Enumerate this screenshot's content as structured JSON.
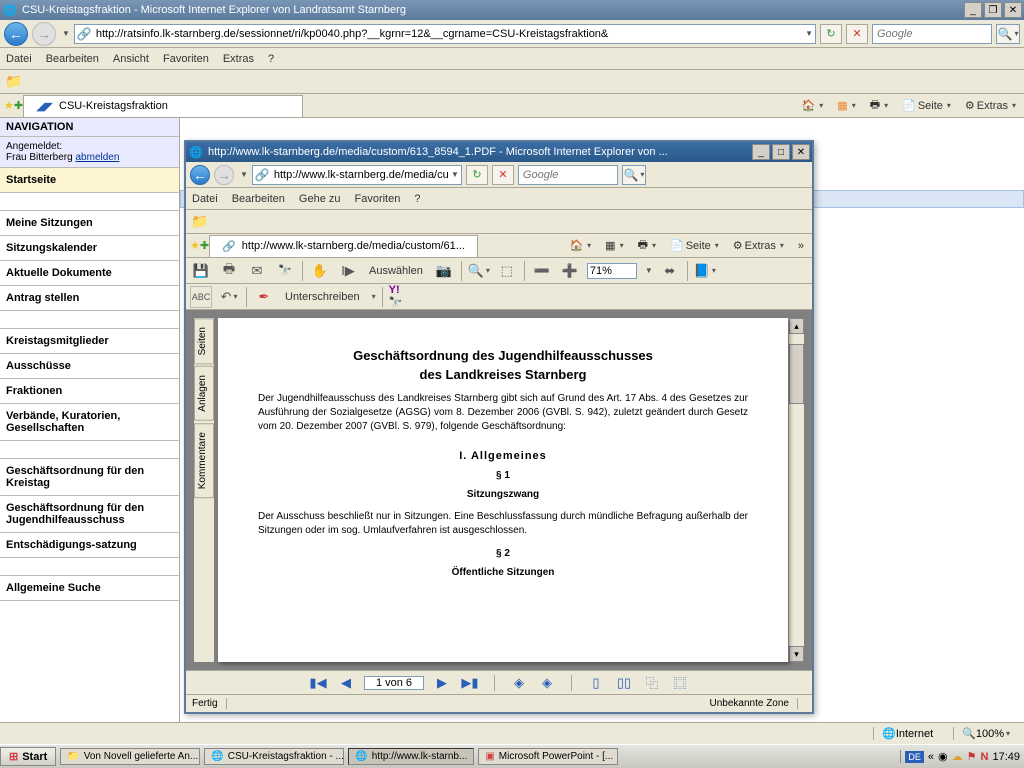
{
  "main_window": {
    "title": "CSU-Kreistagsfraktion - Microsoft Internet Explorer von Landratsamt Starnberg",
    "url": "http://ratsinfo.lk-starnberg.de/sessionnet/ri/kp0040.php?__kgrnr=12&__cgrname=CSU-Kreistagsfraktion&",
    "search_placeholder": "Google",
    "menu": {
      "datei": "Datei",
      "bearbeiten": "Bearbeiten",
      "ansicht": "Ansicht",
      "favoriten": "Favoriten",
      "extras": "Extras",
      "hilfe": "?"
    },
    "tab_label": "CSU-Kreistagsfraktion",
    "tool_labels": {
      "seite": "Seite",
      "extras": "Extras"
    },
    "status": {
      "internet": "Internet",
      "zoom": "100%"
    }
  },
  "sidebar": {
    "header": "NAVIGATION",
    "login_label": "Angemeldet:",
    "login_user": "Frau Bitterberg",
    "logout": "abmelden",
    "items": [
      "Startseite",
      "Meine Sitzungen",
      "Sitzungskalender",
      "Aktuelle Dokumente",
      "Antrag stellen",
      "Kreistagsmitglieder",
      "Ausschüsse",
      "Fraktionen",
      "Verbände, Kuratorien, Gesellschaften",
      "Geschäftsordnung für den Kreistag",
      "Geschäftsordnung für den Jugendhilfeausschuss",
      "Entschädigungs-satzung",
      "Allgemeine Suche"
    ]
  },
  "pdf_window": {
    "title": "http://www.lk-starnberg.de/media/custom/613_8594_1.PDF - Microsoft Internet Explorer von ...",
    "url": "http://www.lk-starnberg.de/media/custom",
    "addr_display": "http://www.lk-starnberg.de/media/custom/61...",
    "search_placeholder": "Google",
    "menu": {
      "datei": "Datei",
      "bearbeiten": "Bearbeiten",
      "gehezu": "Gehe zu",
      "favoriten": "Favoriten",
      "hilfe": "?"
    },
    "tool_labels": {
      "seite": "Seite",
      "extras": "Extras"
    },
    "pdf_toolbar": {
      "auswaehlen": "Auswählen",
      "unterschreiben": "Unterschreiben",
      "zoom": "71%"
    },
    "sidetabs": {
      "seiten": "Seiten",
      "anlagen": "Anlagen",
      "kommentare": "Kommentare"
    },
    "pager": "1 von 6",
    "status": {
      "fertig": "Fertig",
      "zone": "Unbekannte Zone"
    },
    "document": {
      "title1": "Geschäftsordnung des Jugendhilfeausschusses",
      "title2": "des Landkreises Starnberg",
      "intro": "Der Jugendhilfeausschuss des Landkreises Starnberg gibt sich auf Grund des Art. 17 Abs. 4 des Gesetzes zur Ausführung der Sozialgesetze (AGSG) vom 8. Dezember 2006 (GVBl. S. 942), zuletzt geändert durch Gesetz vom 20. Dezember 2007 (GVBl. S. 979), folgende Geschäftsordnung:",
      "s1": "I. Allgemeines",
      "s1_1": "§ 1",
      "s1_1t": "Sitzungszwang",
      "s1_1b": "Der Ausschuss beschließt nur in Sitzungen. Eine Beschlussfassung durch mündliche Befragung außerhalb der Sitzungen oder im sog. Umlaufverfahren ist ausgeschlossen.",
      "s1_2": "§ 2",
      "s1_2t": "Öffentliche Sitzungen"
    }
  },
  "taskbar": {
    "start": "Start",
    "tasks": [
      "Von Novell gelieferte An...",
      "CSU-Kreistagsfraktion - ...",
      "http://www.lk-starnb...",
      "Microsoft PowerPoint - [..."
    ],
    "lang": "DE",
    "time": "17:49"
  }
}
